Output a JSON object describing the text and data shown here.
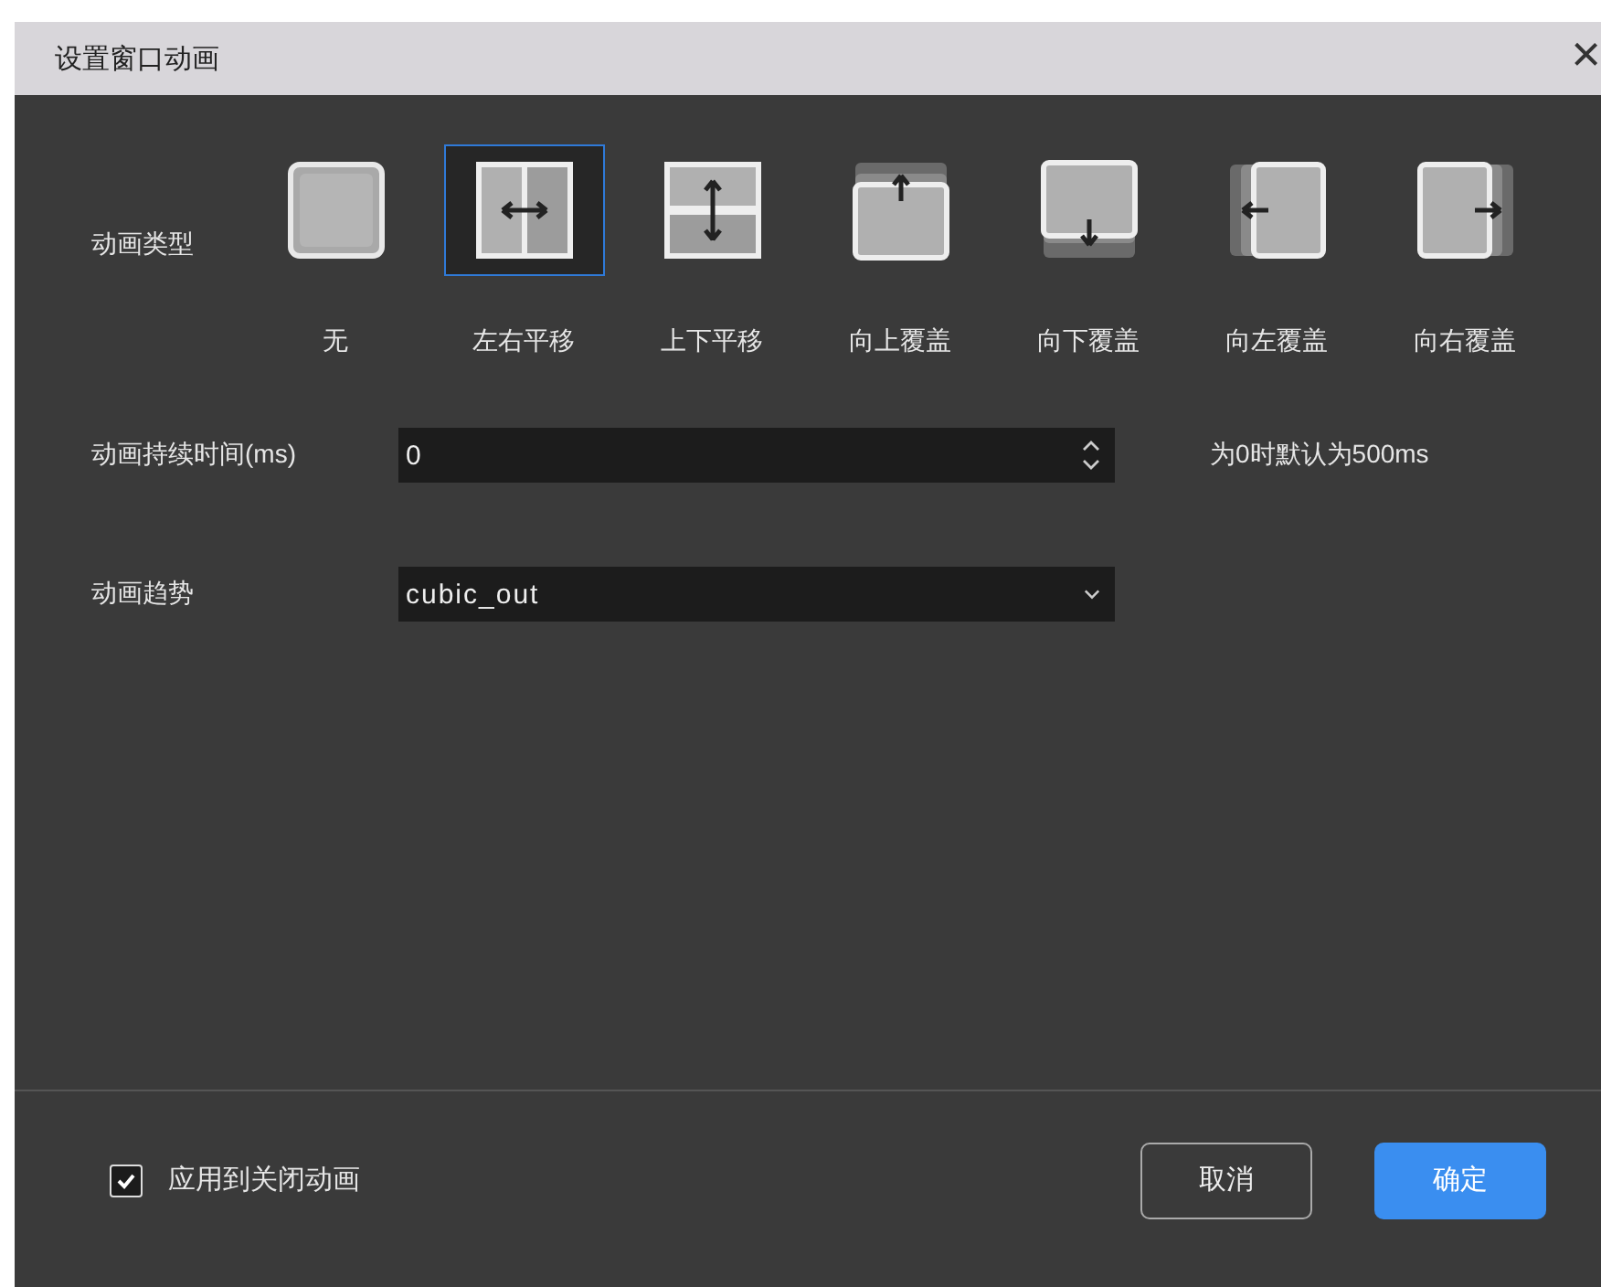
{
  "window": {
    "title": "设置窗口动画",
    "close": "×"
  },
  "animation_type": {
    "label": "动画类型",
    "options": [
      {
        "kind": "none",
        "label": "无",
        "selected": false
      },
      {
        "kind": "slide_h",
        "label": "左右平移",
        "selected": true
      },
      {
        "kind": "slide_v",
        "label": "上下平移",
        "selected": false
      },
      {
        "kind": "cover_up",
        "label": "向上覆盖",
        "selected": false
      },
      {
        "kind": "cover_down",
        "label": "向下覆盖",
        "selected": false
      },
      {
        "kind": "cover_left",
        "label": "向左覆盖",
        "selected": false
      },
      {
        "kind": "cover_right",
        "label": "向右覆盖",
        "selected": false
      }
    ]
  },
  "duration": {
    "label": "动画持续时间(ms)",
    "value": "0",
    "hint": "为0时默认为500ms"
  },
  "easing": {
    "label": "动画趋势",
    "value": "cubic_out"
  },
  "apply_to_close": {
    "label": "应用到关闭动画",
    "checked": true
  },
  "buttons": [
    {
      "kind": "secondary",
      "label": "取消"
    },
    {
      "kind": "primary",
      "label": "确定"
    }
  ]
}
